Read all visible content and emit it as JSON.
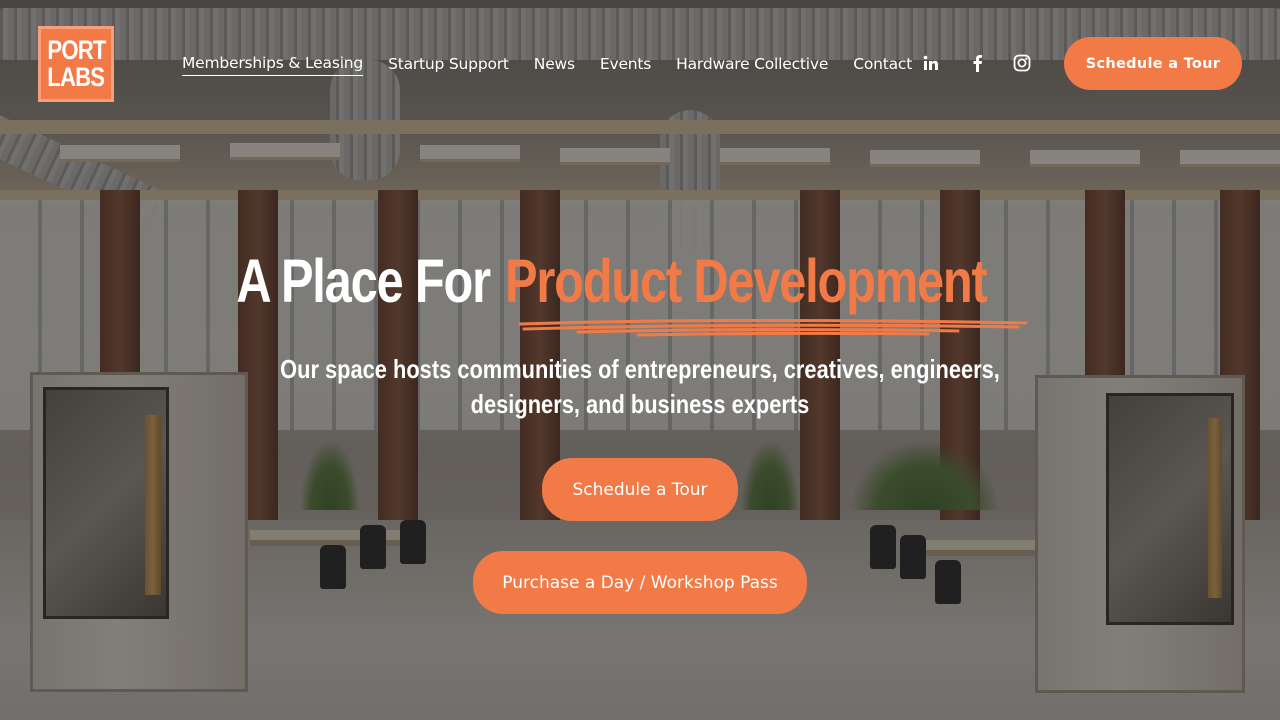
{
  "colors": {
    "accent": "#f27a47",
    "text": "#ffffff"
  },
  "logo": {
    "line1": "PORT",
    "line2": "LABS"
  },
  "nav": {
    "items": [
      {
        "label": "Memberships & Leasing",
        "active": true
      },
      {
        "label": "Startup Support"
      },
      {
        "label": "News"
      },
      {
        "label": "Events"
      },
      {
        "label": "Hardware Collective"
      },
      {
        "label": "Contact"
      }
    ],
    "social": [
      {
        "icon": "linkedin-icon"
      },
      {
        "icon": "facebook-icon"
      },
      {
        "icon": "instagram-icon"
      }
    ],
    "cta_label": "Schedule a Tour"
  },
  "hero": {
    "title_white": "A Place For",
    "title_accent": "Product Development",
    "subtitle": "Our space hosts communities of entrepreneurs, creatives, engineers, designers, and business experts",
    "primary_button": "Schedule a Tour",
    "secondary_button": "Purchase a Day / Workshop Pass"
  }
}
